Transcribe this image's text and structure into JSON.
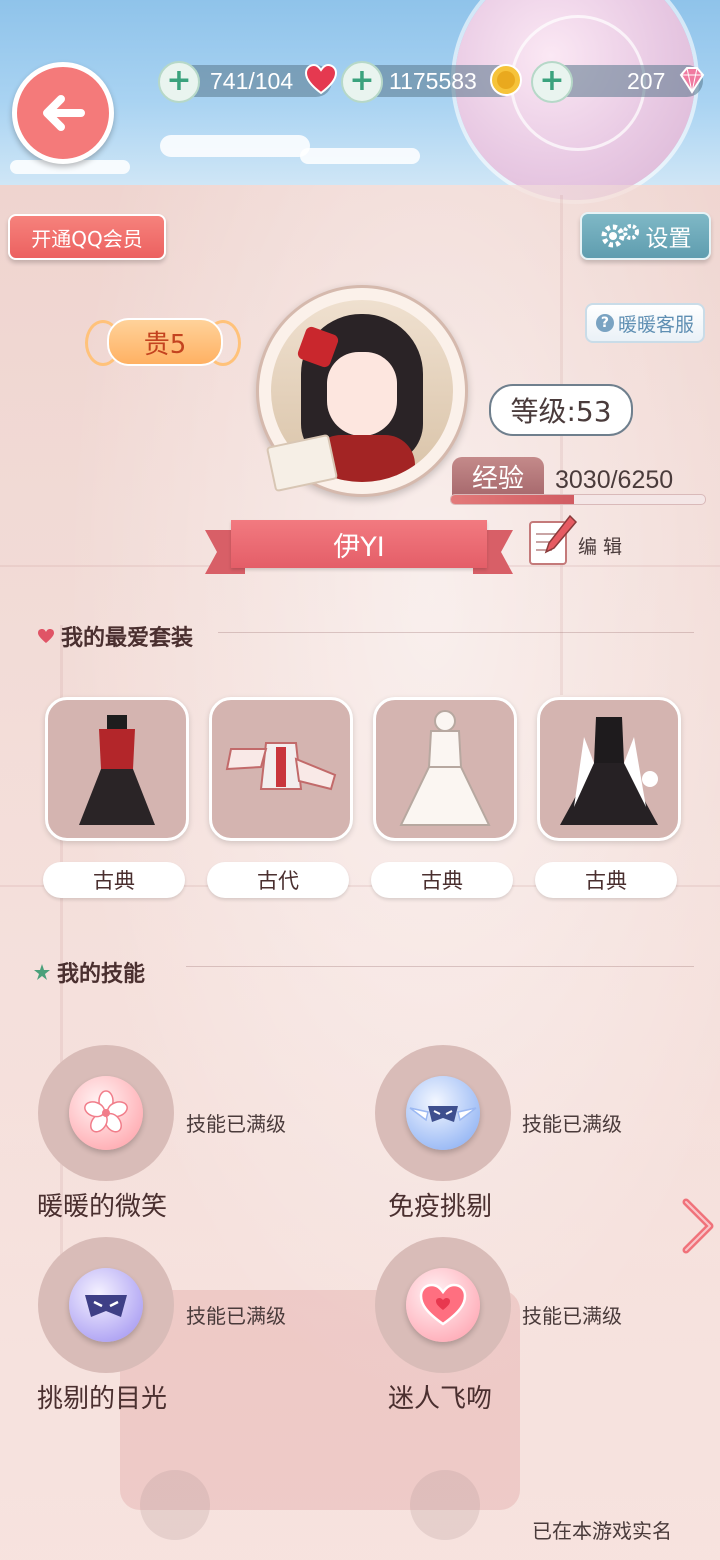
{
  "topbar": {
    "resources": [
      {
        "value": "741/104",
        "icon": "heart-icon"
      },
      {
        "value": "1175583",
        "icon": "gold-coin-icon"
      },
      {
        "value": "207",
        "icon": "diamond-icon"
      }
    ]
  },
  "buttons": {
    "qq_member": "开通QQ会员",
    "settings": "设置",
    "support": "暖暖客服"
  },
  "profile": {
    "vip": "贵5",
    "level": "等级:53",
    "exp_label": "经验",
    "exp_value": "3030/6250",
    "exp_fraction": 0.485,
    "name": "伊YI",
    "edit_label": "编 辑"
  },
  "favorites": {
    "title": "我的最爱套装",
    "suits": [
      {
        "tag": "古典"
      },
      {
        "tag": "古代"
      },
      {
        "tag": "古典"
      },
      {
        "tag": "古典"
      }
    ]
  },
  "skills": {
    "title": "我的技能",
    "items": [
      {
        "name": "暖暖的微笑",
        "status": "技能已满级",
        "icon": "sakura-icon"
      },
      {
        "name": "免疫挑剔",
        "status": "技能已满级",
        "icon": "winged-mask-icon"
      },
      {
        "name": "挑剔的目光",
        "status": "技能已满级",
        "icon": "mask-icon"
      },
      {
        "name": "迷人飞吻",
        "status": "技能已满级",
        "icon": "heart-kiss-icon"
      }
    ]
  },
  "footer": {
    "text": "已在本游戏实名"
  },
  "colors": {
    "accent": "#ec6160",
    "settings": "#5f9daf",
    "vip": "#ffb163"
  }
}
